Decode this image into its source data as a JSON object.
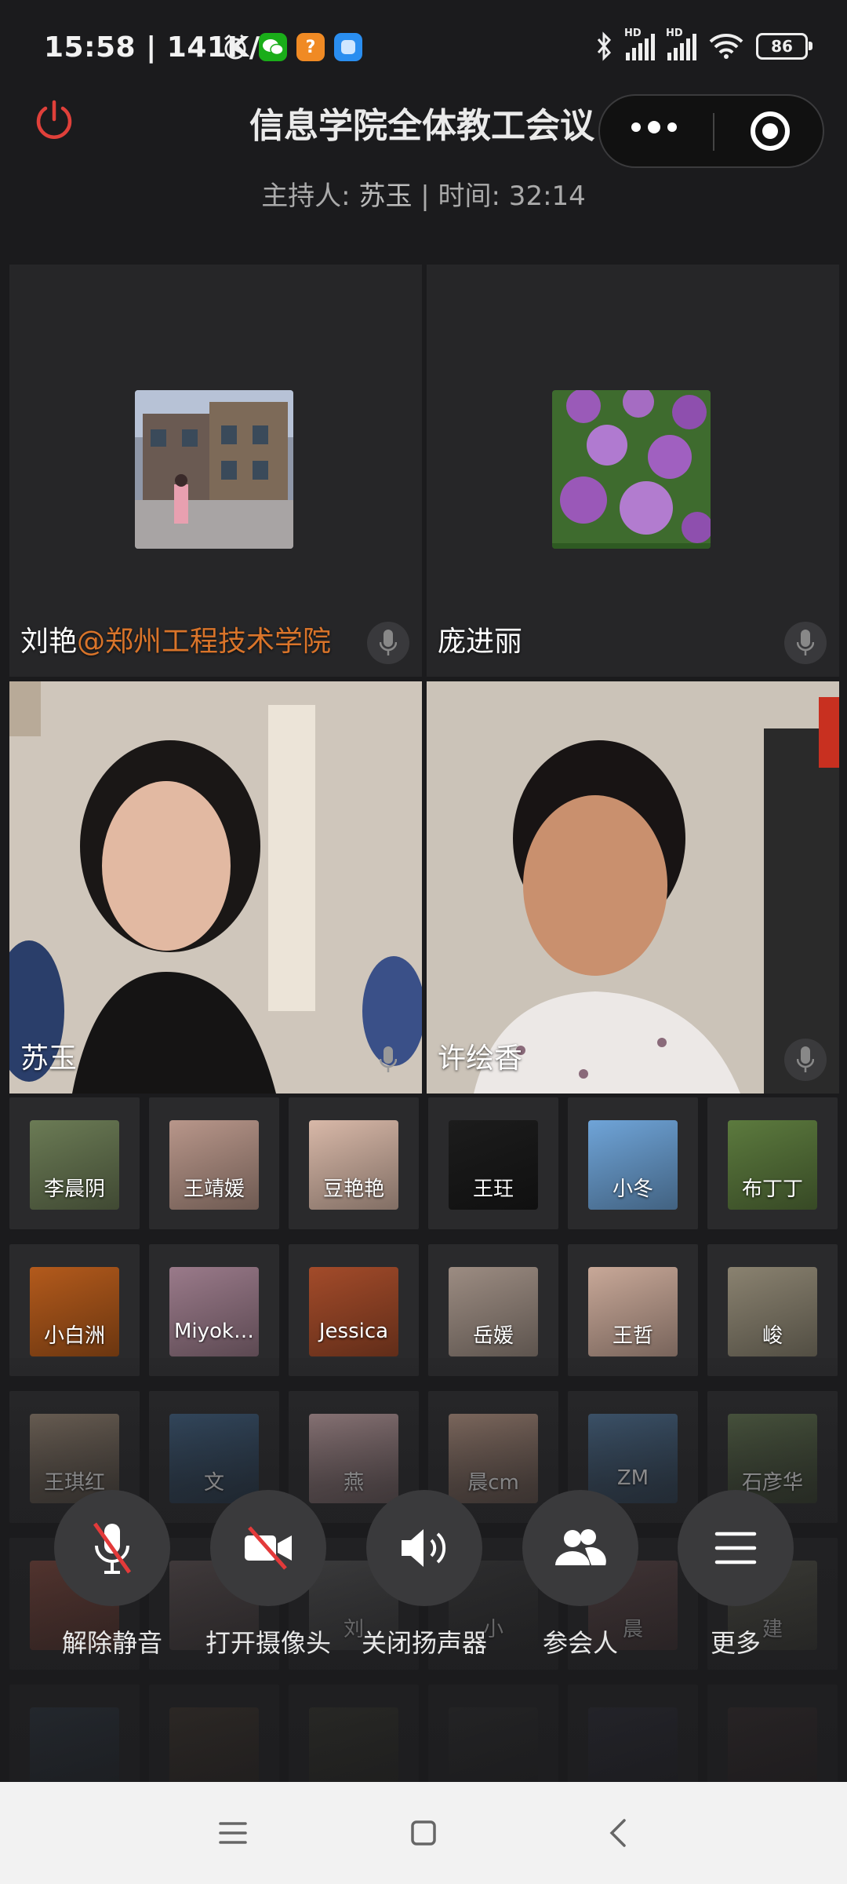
{
  "status_bar": {
    "time": "15:58 | 141K/s",
    "battery": "86",
    "app_icons": [
      "alarm-icon",
      "wechat-icon",
      "orange-app-icon",
      "blue-app-icon"
    ]
  },
  "header": {
    "title": "信息学院全体教工会议",
    "host_label": "主持人:",
    "host_name": "苏玉",
    "time_label": "| 时间: 32:14"
  },
  "main_tiles": [
    {
      "name": "刘艳",
      "org": "@郑州工程技术学院",
      "type": "avatar"
    },
    {
      "name": "庞进丽",
      "org": "",
      "type": "avatar"
    },
    {
      "name": "苏玉",
      "org": "",
      "type": "video"
    },
    {
      "name": "许绘香",
      "org": "",
      "type": "video"
    }
  ],
  "participants": [
    {
      "name": "李晨阴",
      "color": "#6b7b55"
    },
    {
      "name": "王靖媛",
      "color": "#b8968a"
    },
    {
      "name": "豆艳艳",
      "color": "#d8b8a8"
    },
    {
      "name": "王玨",
      "color": "#1c1c1c"
    },
    {
      "name": "小冬",
      "color": "#6fa4d8"
    },
    {
      "name": "布丁丁",
      "color": "#5c7a3e"
    },
    {
      "name": "小白洲",
      "color": "#b35a1c"
    },
    {
      "name": "Miyok…",
      "color": "#9a7a8a"
    },
    {
      "name": "Jessica",
      "color": "#a34b2a"
    },
    {
      "name": "岳媛",
      "color": "#9c8c82"
    },
    {
      "name": "王哲",
      "color": "#c8a898"
    },
    {
      "name": "峻",
      "color": "#8a8270"
    },
    {
      "name": "王琪红",
      "color": "#8a7a6a"
    },
    {
      "name": "文",
      "color": "#3d5a78"
    },
    {
      "name": "燕",
      "color": "#b89a9c"
    },
    {
      "name": "晨cm",
      "color": "#a88a7a"
    },
    {
      "name": "ZM",
      "color": "#4a6a8a"
    },
    {
      "name": "石彦华",
      "color": "#5a6a4a"
    },
    {
      "name": "",
      "color": "#a85a4a"
    },
    {
      "name": "",
      "color": "#7a6a6a"
    },
    {
      "name": "刘",
      "color": "#6a6a6a"
    },
    {
      "name": "小",
      "color": "#4a4a4a"
    },
    {
      "name": "晨",
      "color": "#7a5a5a"
    },
    {
      "name": "建",
      "color": "#6a6a5a"
    },
    {
      "name": "",
      "color": "#3a4a5a"
    },
    {
      "name": "",
      "color": "#5a4a3a"
    },
    {
      "name": "",
      "color": "#4a4a3a"
    },
    {
      "name": "",
      "color": "#3a3a3a"
    },
    {
      "name": "",
      "color": "#3a3a4a"
    },
    {
      "name": "",
      "color": "#4a3a3a"
    }
  ],
  "controls": [
    {
      "label": "解除静音",
      "icon": "muted-mic-icon"
    },
    {
      "label": "打开摄像头",
      "icon": "camera-off-icon"
    },
    {
      "label": "关闭扬声器",
      "icon": "speaker-icon"
    },
    {
      "label": "参会人",
      "icon": "participants-icon"
    },
    {
      "label": "更多",
      "icon": "menu-icon"
    }
  ],
  "colors": {
    "accent_org": "#d9742a",
    "power": "#e0403a",
    "background": "#1b1b1d"
  }
}
